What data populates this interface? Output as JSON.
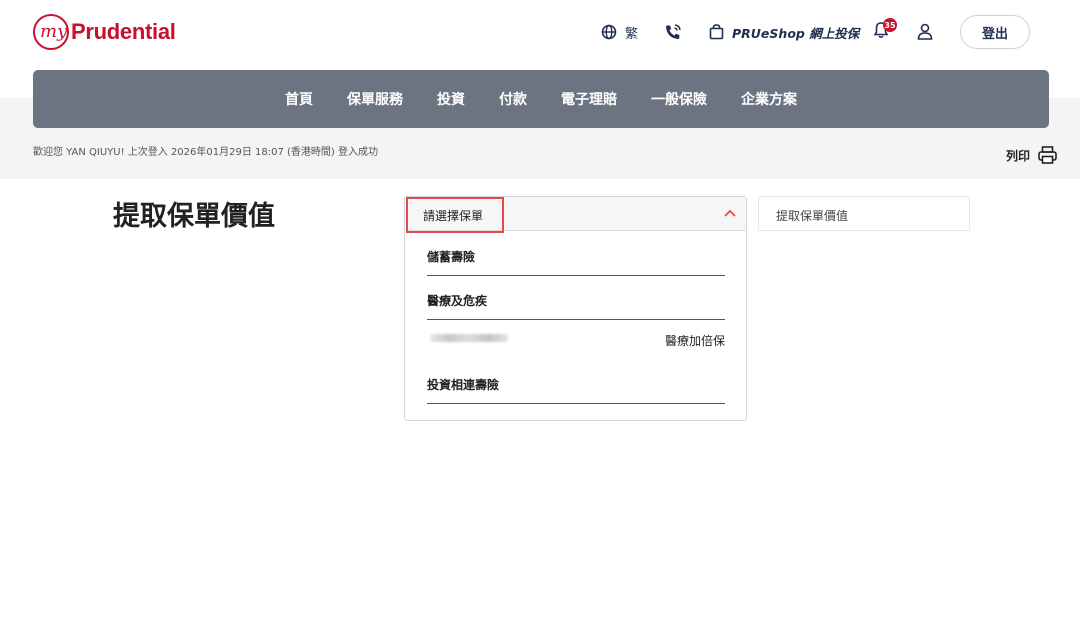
{
  "header": {
    "logo_my": "my",
    "logo_text": "Prudential",
    "language": "繁",
    "shop_label": "PRUeShop 網上投保",
    "notification_count": "35",
    "logout": "登出"
  },
  "nav": {
    "items": [
      "首頁",
      "保單服務",
      "投資",
      "付款",
      "電子理賠",
      "一般保險",
      "企業方案"
    ]
  },
  "welcome": "歡迎您 YAN QIUYU! 上次登入 2026年01月29日 18:07 (香港時間) 登入成功",
  "print_label": "列印",
  "page_title": "提取保單價值",
  "policy_dropdown": {
    "placeholder": "請選擇保單",
    "categories": [
      "儲蓄壽險",
      "醫療及危疾",
      "投資相連壽險"
    ],
    "policy_name": "醫療加倍保"
  },
  "breadcrumb_box": "提取保單價值",
  "colors": {
    "brand": "#c8102e",
    "nav_bg": "#6b7480",
    "highlight": "#e54a4a"
  }
}
